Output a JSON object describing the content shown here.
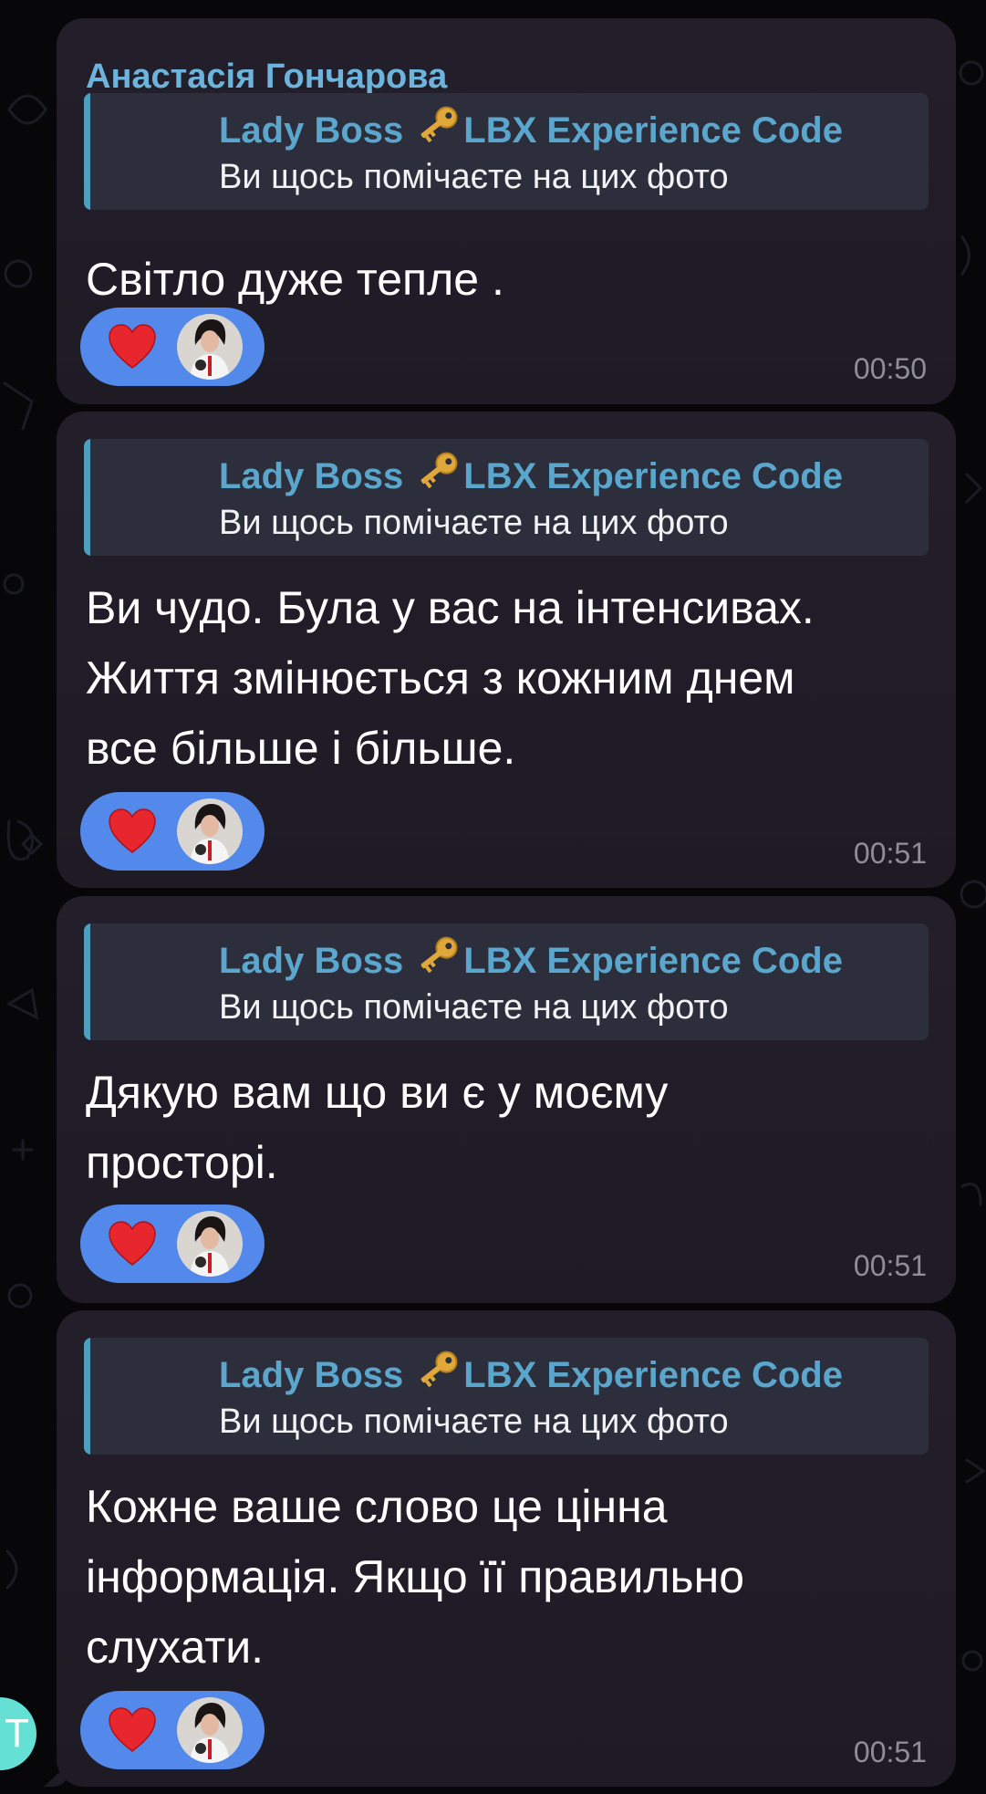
{
  "colors": {
    "background": "#07070a",
    "bubble": "#211e29",
    "sender_name": "#6db4dc",
    "quote_accent": "#4e9fbf",
    "quote_title": "#5aa6cd",
    "reaction_pill": "#5289ea",
    "heart": "#e8262d",
    "time": "#8e8e98"
  },
  "messages": [
    {
      "sender": "Анастасія Гончарова",
      "reply": {
        "title_before": "Lady Boss",
        "icon": "key-icon",
        "title_after": "LBX Experience Code",
        "text": "Ви щось помічаєте на цих фото"
      },
      "lines": [
        "Світло дуже тепле ."
      ],
      "reaction": {
        "emoji": "heart-icon",
        "reactor": "avatar"
      },
      "time": "00:50"
    },
    {
      "reply": {
        "title_before": "Lady Boss",
        "icon": "key-icon",
        "title_after": "LBX Experience Code",
        "text": "Ви щось помічаєте на цих фото"
      },
      "lines": [
        "Ви чудо. Була у вас на інтенсивах.",
        "Життя змінюється з кожним днем",
        "все більше і більше."
      ],
      "reaction": {
        "emoji": "heart-icon",
        "reactor": "avatar"
      },
      "time": "00:51"
    },
    {
      "reply": {
        "title_before": "Lady Boss",
        "icon": "key-icon",
        "title_after": "LBX Experience Code",
        "text": "Ви щось помічаєте на цих фото"
      },
      "lines": [
        "Дякую вам що ви є у моєму",
        "просторі."
      ],
      "reaction": {
        "emoji": "heart-icon",
        "reactor": "avatar"
      },
      "time": "00:51"
    },
    {
      "reply": {
        "title_before": "Lady Boss",
        "icon": "key-icon",
        "title_after": "LBX Experience Code",
        "text": "Ви щось помічаєте на цих фото"
      },
      "lines": [
        "Кожне ваше слово це цінна",
        "інформація. Якщо її правильно",
        "слухати."
      ],
      "reaction": {
        "emoji": "heart-icon",
        "reactor": "avatar"
      },
      "time": "00:51"
    }
  ],
  "sender_avatar_initial": "Т"
}
